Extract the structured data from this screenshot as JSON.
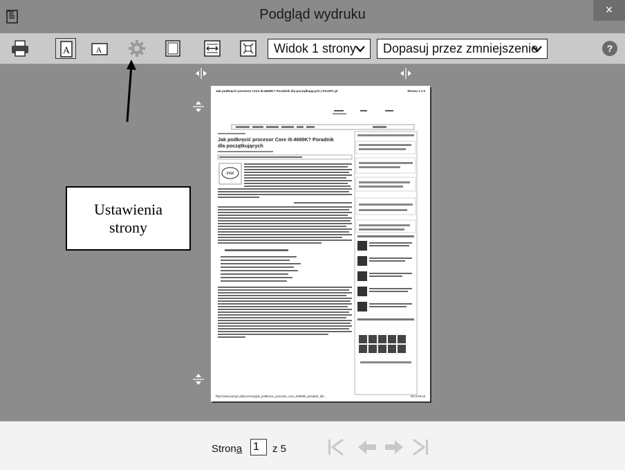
{
  "window": {
    "title": "Podgląd wydruku",
    "close_label": "×"
  },
  "toolbar": {
    "view_select": "Widok 1 strony",
    "fit_select": "Dopasuj przez zmniejszenie",
    "caret": "❯"
  },
  "callout": {
    "line1": "Ustawienia",
    "line2": "strony"
  },
  "preview": {
    "header_left": "Jak podkręcić procesor Core i5-4690K? Poradnik dla początkujących | PurePC.pl",
    "header_right": "Strona 1 z 5",
    "article_title_1": "Jak podkręcić procesor Core i5-4690K? Poradnik",
    "article_title_2": "dla początkujących",
    "footer_left": "http://www.purepc.pl/procesory/jak_podkrecic_procesor_core_i54690k_poradnik_dla...",
    "footer_right": "2014-09-15"
  },
  "status": {
    "page_label_prefix": "Stron",
    "page_label_underlined": "a",
    "current_page": "1",
    "total_pages": "z 5"
  },
  "colors": {
    "titlebar": "#8a8a8a",
    "toolbar": "#c9c9c9",
    "workarea": "#8c8c8c",
    "nav_disabled": "#c8c8c8"
  }
}
